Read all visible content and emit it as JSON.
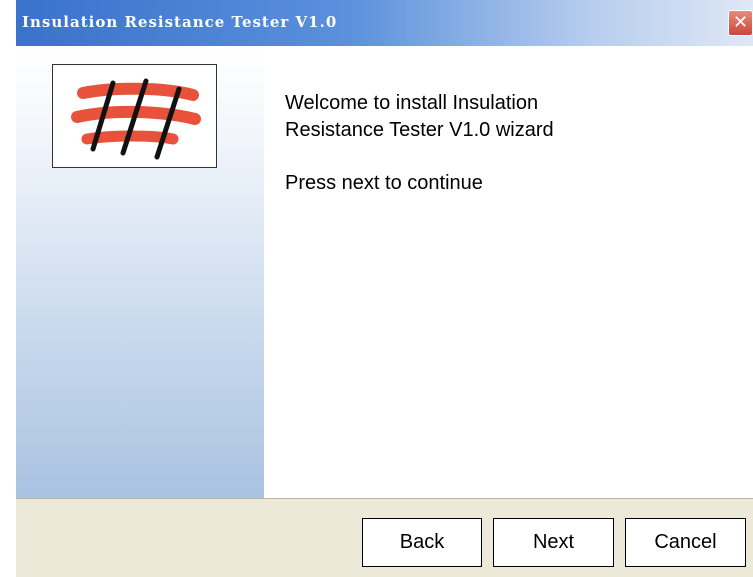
{
  "window": {
    "title": "Insulation Resistance Tester V1.0"
  },
  "titlebar": {
    "close_icon": "close-icon",
    "close_glyph": "✕"
  },
  "sidebar": {
    "logo_icon": "slashed-logo-icon"
  },
  "content": {
    "welcome_line1": "Welcome to install Insulation",
    "welcome_line2": "Resistance Tester V1.0 wizard",
    "instruction": "Press next to continue"
  },
  "buttons": {
    "back": "Back",
    "next": "Next",
    "cancel": "Cancel"
  },
  "colors": {
    "titlebar_accent": "#3a72cc",
    "logo_red": "#e8513a",
    "button_bar": "#ece9d8"
  }
}
